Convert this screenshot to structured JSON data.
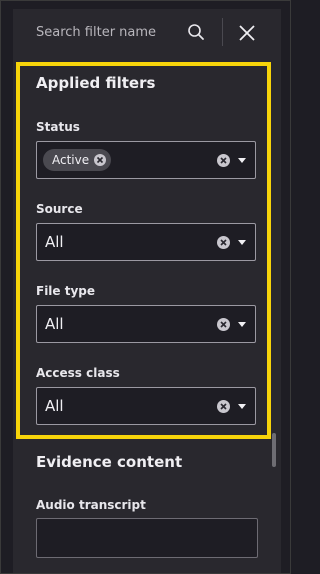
{
  "search": {
    "placeholder": "Search filter name",
    "search_icon": "search-icon",
    "close_icon": "close-icon"
  },
  "applied_filters": {
    "title": "Applied filters",
    "highlight_color": "#f7d40a",
    "fields": [
      {
        "label": "Status",
        "chips": [
          "Active"
        ]
      },
      {
        "label": "Source",
        "value": "All"
      },
      {
        "label": "File type",
        "value": "All"
      },
      {
        "label": "Access class",
        "value": "All"
      }
    ]
  },
  "evidence_content": {
    "title": "Evidence content",
    "fields": [
      {
        "label": "Audio transcript",
        "value": ""
      }
    ]
  }
}
